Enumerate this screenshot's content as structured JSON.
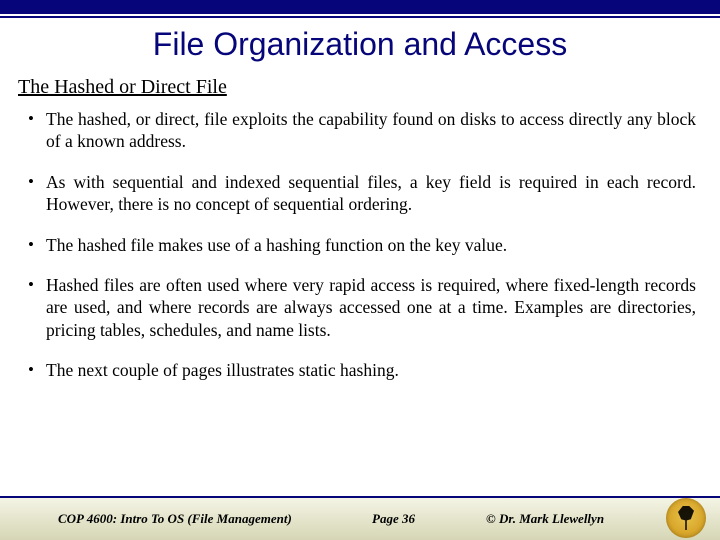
{
  "title": "File Organization and Access",
  "subheading": "The Hashed or Direct File",
  "bullets": [
    "The hashed, or direct, file exploits the capability found on disks to access directly any block of a known address.",
    "As with sequential and indexed sequential files, a key field is required in each record.  However, there is no concept of sequential ordering.",
    "The hashed file makes use of a hashing function on the key value.",
    "Hashed files are often used where very rapid access is required, where fixed-length records are used, and where records are always accessed one at a time.  Examples are directories, pricing tables, schedules, and name lists.",
    "The next couple of pages illustrates static hashing."
  ],
  "footer": {
    "course": "COP 4600: Intro To OS  (File Management)",
    "page": "Page 36",
    "author": "© Dr. Mark Llewellyn"
  }
}
